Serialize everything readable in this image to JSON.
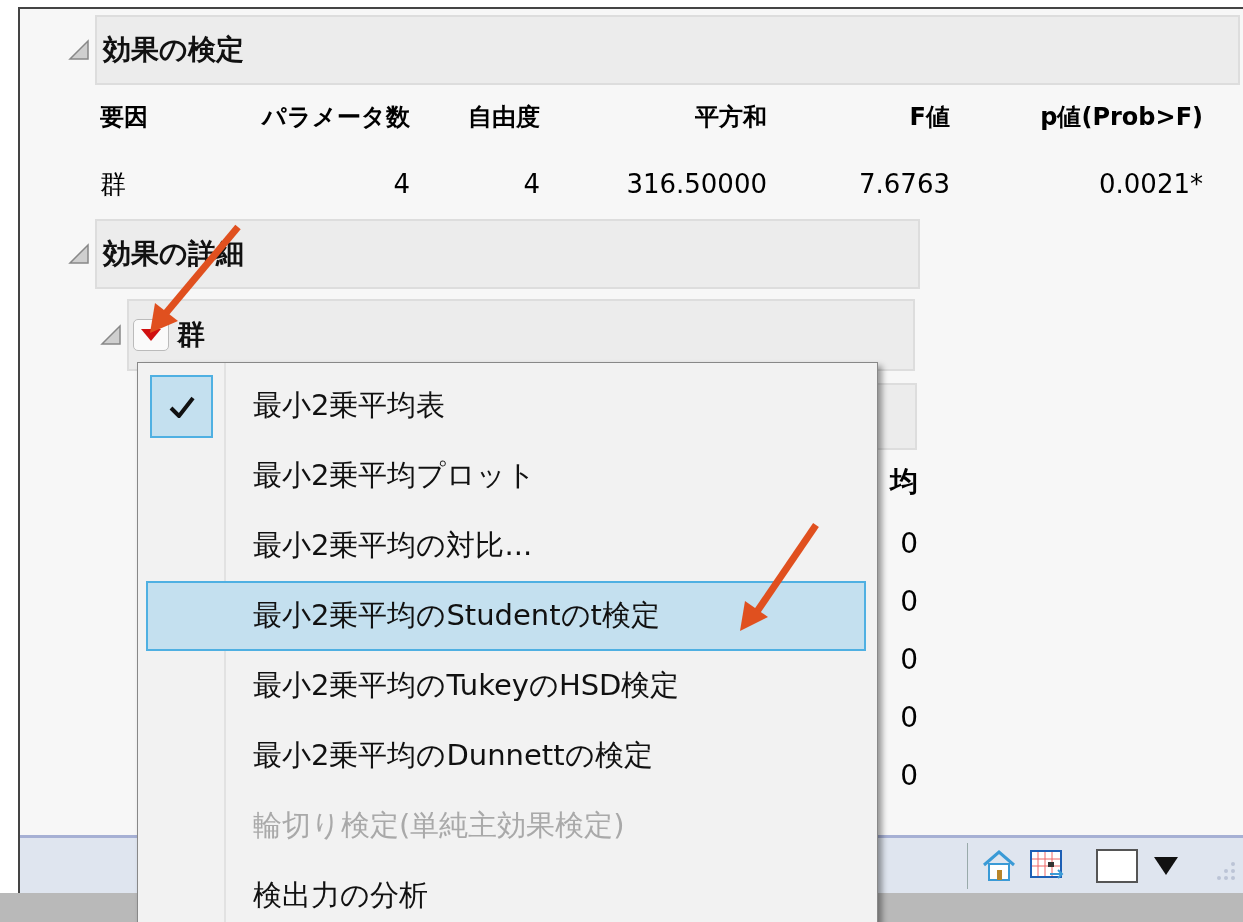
{
  "sections": [
    {
      "title": "効果の検定",
      "expanded": true,
      "table": {
        "columns": [
          "要因",
          "パラメータ数",
          "自由度",
          "平方和",
          "F値",
          "p値(Prob>F)"
        ],
        "rows": [
          [
            "群",
            "4",
            "4",
            "316.50000",
            "7.6763",
            "0.0021*"
          ]
        ]
      }
    },
    {
      "title": "効果の詳細",
      "expanded": true,
      "children": [
        {
          "title": "群",
          "expanded": true,
          "partial_column": {
            "header": "均",
            "cells": [
              "0",
              "0",
              "0",
              "0",
              "0"
            ]
          }
        }
      ]
    }
  ],
  "menu": {
    "items": [
      {
        "label": "最小2乗平均表",
        "checked": true,
        "selected": false,
        "disabled": false
      },
      {
        "label": "最小2乗平均プロット",
        "checked": false,
        "selected": false,
        "disabled": false
      },
      {
        "label": "最小2乗平均の対比...",
        "checked": false,
        "selected": false,
        "disabled": false
      },
      {
        "label": "最小2乗平均のStudentのt検定",
        "checked": false,
        "selected": true,
        "disabled": false
      },
      {
        "label": "最小2乗平均のTukeyのHSD検定",
        "checked": false,
        "selected": false,
        "disabled": false
      },
      {
        "label": "最小2乗平均のDunnettの検定",
        "checked": false,
        "selected": false,
        "disabled": false
      },
      {
        "label": "輪切り検定(単純主効果検定)",
        "checked": false,
        "selected": false,
        "disabled": true
      },
      {
        "label": "検出力の分析",
        "checked": false,
        "selected": false,
        "disabled": false
      }
    ]
  }
}
